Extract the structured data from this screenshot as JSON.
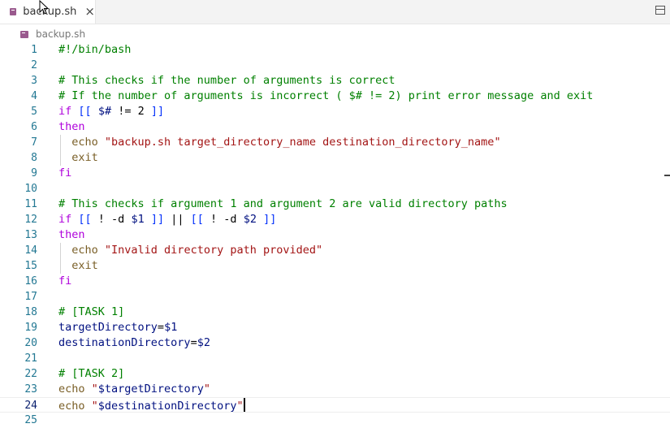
{
  "tab": {
    "label": "backup.sh",
    "close": "×"
  },
  "breadcrumb": {
    "label": "backup.sh"
  },
  "editor": {
    "current_line": 24,
    "lines": [
      {
        "n": "1",
        "tokens": [
          {
            "t": "#!/bin/bash",
            "c": "comment"
          }
        ]
      },
      {
        "n": "2",
        "tokens": []
      },
      {
        "n": "3",
        "tokens": [
          {
            "t": "# This checks if the number of arguments is correct",
            "c": "comment"
          }
        ]
      },
      {
        "n": "4",
        "tokens": [
          {
            "t": "# If the number of arguments is incorrect ( $# != 2) print error message and exit",
            "c": "comment"
          }
        ]
      },
      {
        "n": "5",
        "tokens": [
          {
            "t": "if",
            "c": "keyword"
          },
          {
            "t": " ",
            "c": "plain"
          },
          {
            "t": "[[",
            "c": "bracket"
          },
          {
            "t": " ",
            "c": "plain"
          },
          {
            "t": "$#",
            "c": "var"
          },
          {
            "t": " != 2 ",
            "c": "plain"
          },
          {
            "t": "]]",
            "c": "bracket"
          }
        ]
      },
      {
        "n": "6",
        "tokens": [
          {
            "t": "then",
            "c": "keyword"
          }
        ]
      },
      {
        "n": "7",
        "indent": true,
        "tokens": [
          {
            "t": "  echo ",
            "c": "builtin"
          },
          {
            "t": "\"backup.sh target_directory_name destination_directory_name\"",
            "c": "string"
          }
        ]
      },
      {
        "n": "8",
        "indent": true,
        "tokens": [
          {
            "t": "  exit",
            "c": "builtin"
          }
        ]
      },
      {
        "n": "9",
        "tokens": [
          {
            "t": "fi",
            "c": "keyword"
          }
        ]
      },
      {
        "n": "10",
        "tokens": []
      },
      {
        "n": "11",
        "tokens": [
          {
            "t": "# This checks if argument 1 and argument 2 are valid directory paths",
            "c": "comment"
          }
        ]
      },
      {
        "n": "12",
        "tokens": [
          {
            "t": "if",
            "c": "keyword"
          },
          {
            "t": " ",
            "c": "plain"
          },
          {
            "t": "[[",
            "c": "bracket"
          },
          {
            "t": " ! -d ",
            "c": "plain"
          },
          {
            "t": "$1",
            "c": "var"
          },
          {
            "t": " ",
            "c": "plain"
          },
          {
            "t": "]]",
            "c": "bracket"
          },
          {
            "t": " || ",
            "c": "plain"
          },
          {
            "t": "[[",
            "c": "bracket"
          },
          {
            "t": " ! -d ",
            "c": "plain"
          },
          {
            "t": "$2",
            "c": "var"
          },
          {
            "t": " ",
            "c": "plain"
          },
          {
            "t": "]]",
            "c": "bracket"
          }
        ]
      },
      {
        "n": "13",
        "tokens": [
          {
            "t": "then",
            "c": "keyword"
          }
        ]
      },
      {
        "n": "14",
        "indent": true,
        "tokens": [
          {
            "t": "  echo ",
            "c": "builtin"
          },
          {
            "t": "\"Invalid directory path provided\"",
            "c": "string"
          }
        ]
      },
      {
        "n": "15",
        "indent": true,
        "tokens": [
          {
            "t": "  exit",
            "c": "builtin"
          }
        ]
      },
      {
        "n": "16",
        "tokens": [
          {
            "t": "fi",
            "c": "keyword"
          }
        ]
      },
      {
        "n": "17",
        "tokens": []
      },
      {
        "n": "18",
        "tokens": [
          {
            "t": "# [TASK 1]",
            "c": "comment"
          }
        ]
      },
      {
        "n": "19",
        "tokens": [
          {
            "t": "targetDirectory",
            "c": "var"
          },
          {
            "t": "=",
            "c": "plain"
          },
          {
            "t": "$1",
            "c": "var"
          }
        ]
      },
      {
        "n": "20",
        "tokens": [
          {
            "t": "destinationDirectory",
            "c": "var"
          },
          {
            "t": "=",
            "c": "plain"
          },
          {
            "t": "$2",
            "c": "var"
          }
        ]
      },
      {
        "n": "21",
        "tokens": []
      },
      {
        "n": "22",
        "tokens": [
          {
            "t": "# [TASK 2]",
            "c": "comment"
          }
        ]
      },
      {
        "n": "23",
        "tokens": [
          {
            "t": "echo ",
            "c": "builtin"
          },
          {
            "t": "\"",
            "c": "string"
          },
          {
            "t": "$targetDirectory",
            "c": "var"
          },
          {
            "t": "\"",
            "c": "string"
          }
        ]
      },
      {
        "n": "24",
        "tokens": [
          {
            "t": "echo ",
            "c": "builtin"
          },
          {
            "t": "\"",
            "c": "string"
          },
          {
            "t": "$destinationDirectory",
            "c": "var"
          },
          {
            "t": "\"",
            "c": "string"
          }
        ]
      },
      {
        "n": "25",
        "tokens": []
      }
    ]
  },
  "colors": {
    "comment": "#008000",
    "keyword": "#af00db",
    "string": "#a31515",
    "variable": "#001080",
    "bracket": "#0431fa",
    "builtin": "#795e26",
    "line_number": "#237893"
  },
  "icons": {
    "file": "shell-file-icon",
    "close": "close-icon",
    "split": "split-editor-icon",
    "cursor": "mouse-pointer-icon"
  }
}
